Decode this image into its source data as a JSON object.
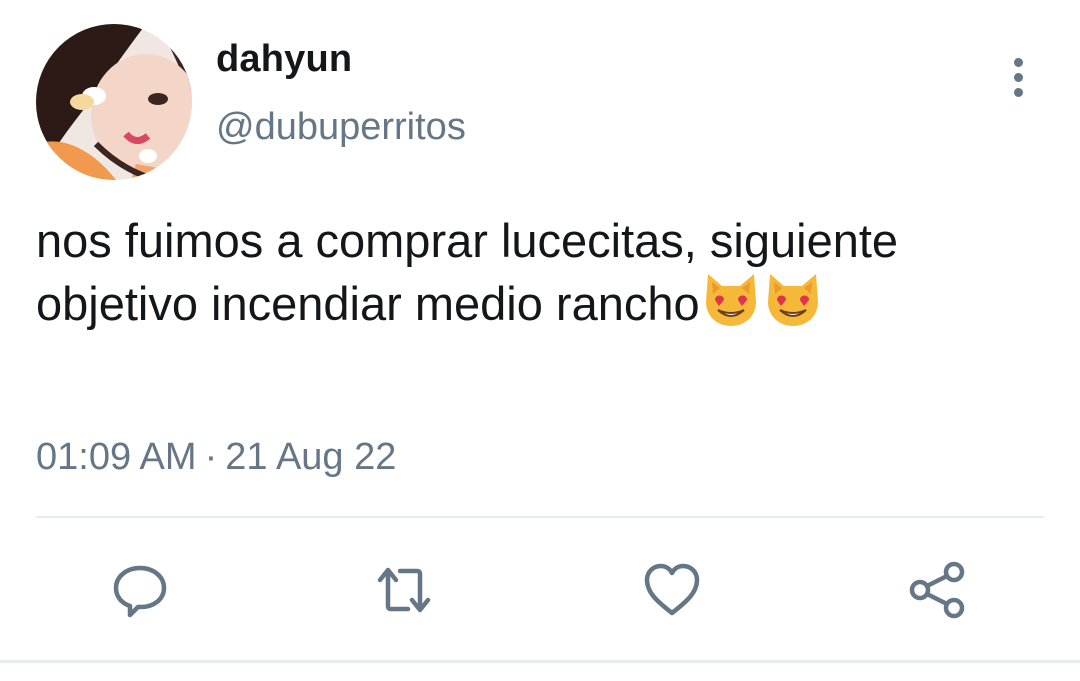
{
  "tweet": {
    "author_name": "dahyun",
    "author_handle": "@dubuperritos",
    "text": "nos fuimos a comprar lucecitas, siguiente objetivo incendiar medio rancho",
    "emojis": [
      "smiling-cat-heart-eyes",
      "smiling-cat-heart-eyes"
    ],
    "time": "01:09 AM",
    "separator": "·",
    "date": "21 Aug 22"
  },
  "actions": [
    {
      "name": "reply",
      "icon": "reply-icon"
    },
    {
      "name": "retweet",
      "icon": "retweet-icon"
    },
    {
      "name": "like",
      "icon": "heart-icon"
    },
    {
      "name": "share",
      "icon": "share-icon"
    }
  ],
  "colors": {
    "text": "#14171a",
    "secondary": "#657786",
    "divider": "#e6ecf0",
    "emoji": "#f5b839"
  }
}
